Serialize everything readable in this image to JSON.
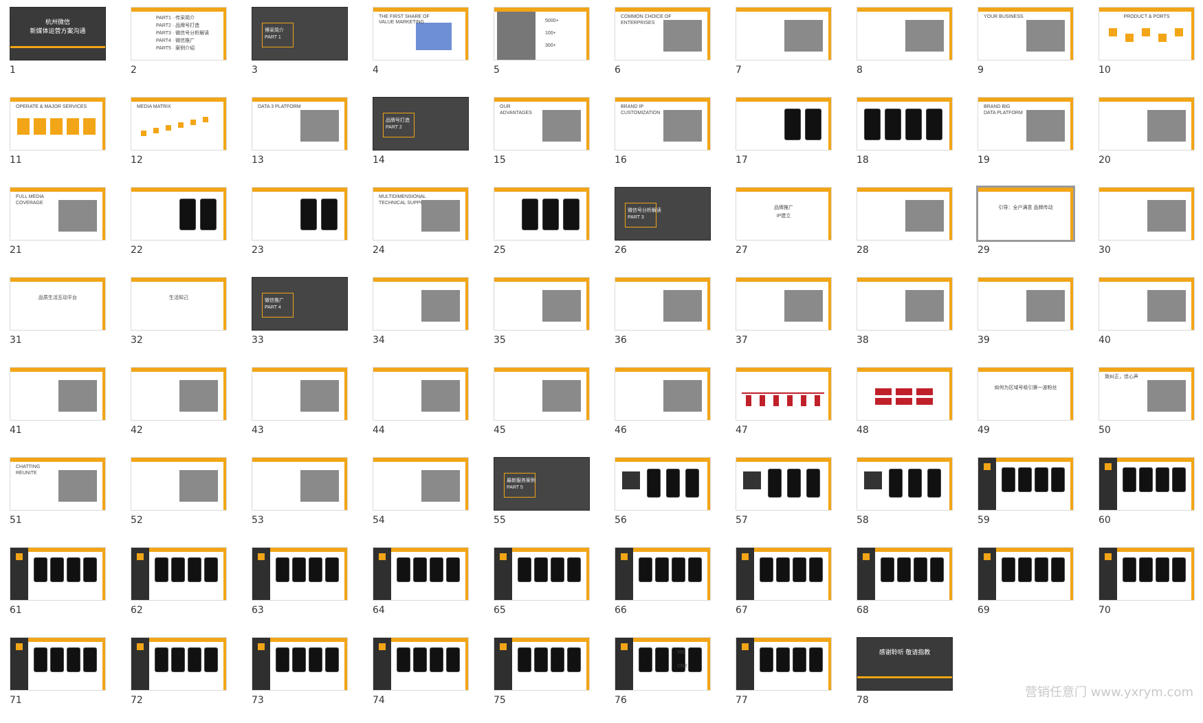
{
  "watermark": "营销任意门 www.yxrym.com",
  "colors": {
    "accent": "#f2a516",
    "dark": "#2a2a2a",
    "red": "#c0202a"
  },
  "slides": [
    {
      "n": "1",
      "theme": "dark-cover",
      "texts": [
        "杭州微信",
        "新媒体运营方案沟通"
      ]
    },
    {
      "n": "2",
      "theme": "agenda",
      "texts": [
        "PART1 · 传采简介",
        "PART2 · 品牌号打造",
        "PART3 · 微信号分析解读",
        "PART4 · 微信推广",
        "PART5 · 案例介绍"
      ]
    },
    {
      "n": "3",
      "theme": "dark-section",
      "texts": [
        "博采简介",
        "PART 1"
      ]
    },
    {
      "n": "4",
      "theme": "map",
      "texts": [
        "THE FIRST SHARE OF",
        "VALUE MARKETING"
      ]
    },
    {
      "n": "5",
      "theme": "stats",
      "texts": [
        "5000+",
        "100+",
        "300+"
      ]
    },
    {
      "n": "6",
      "theme": "bulb",
      "texts": [
        "COMMON CHOICE OF",
        "ENTERPRISES"
      ]
    },
    {
      "n": "7",
      "theme": "logos",
      "texts": []
    },
    {
      "n": "8",
      "theme": "circles",
      "texts": []
    },
    {
      "n": "9",
      "theme": "blue-split",
      "texts": [
        "YOUR BUSINESS"
      ]
    },
    {
      "n": "10",
      "theme": "wave",
      "texts": [
        "PRODUCT & PORTS"
      ]
    },
    {
      "n": "11",
      "theme": "triangles",
      "texts": [
        "OPERATE & MAJOR SERVICES"
      ]
    },
    {
      "n": "12",
      "theme": "timeline",
      "texts": [
        "MEDIA MATRIX"
      ]
    },
    {
      "n": "13",
      "theme": "boxes",
      "texts": [
        "DATA 3 PLATFORM"
      ]
    },
    {
      "n": "14",
      "theme": "dark-section",
      "texts": [
        "品牌号打造",
        "PART 2"
      ]
    },
    {
      "n": "15",
      "theme": "stairs",
      "texts": [
        "OUR",
        "ADVANTAGES"
      ]
    },
    {
      "n": "16",
      "theme": "spiral",
      "texts": [
        "BRAND IP",
        "CUSTOMIZATION"
      ]
    },
    {
      "n": "17",
      "theme": "phones2",
      "texts": []
    },
    {
      "n": "18",
      "theme": "phones4",
      "texts": []
    },
    {
      "n": "19",
      "theme": "data",
      "texts": [
        "BRAND BIG",
        "DATA PLATFORM"
      ]
    },
    {
      "n": "20",
      "theme": "monitors",
      "texts": []
    },
    {
      "n": "21",
      "theme": "cube",
      "texts": [
        "FULL MEDIA",
        "COVERAGE"
      ]
    },
    {
      "n": "22",
      "theme": "phones2",
      "texts": []
    },
    {
      "n": "23",
      "theme": "phones2",
      "texts": []
    },
    {
      "n": "24",
      "theme": "hex",
      "texts": [
        "MULTIDIMENSIONAL",
        "TECHNICAL SUPPORT"
      ]
    },
    {
      "n": "25",
      "theme": "phones3",
      "texts": []
    },
    {
      "n": "26",
      "theme": "dark-section",
      "texts": [
        "微信号分析解读",
        "PART 3"
      ]
    },
    {
      "n": "27",
      "theme": "text",
      "texts": [
        "品牌推广",
        "IP建立"
      ]
    },
    {
      "n": "28",
      "theme": "arrow",
      "texts": []
    },
    {
      "n": "29",
      "theme": "compare",
      "texts": [
        "引导：全户满意 品牌传动"
      ]
    },
    {
      "n": "30",
      "theme": "flow",
      "texts": []
    },
    {
      "n": "31",
      "theme": "text",
      "texts": [
        "品质生活互动平台"
      ]
    },
    {
      "n": "32",
      "theme": "text",
      "texts": [
        "生活知己"
      ]
    },
    {
      "n": "33",
      "theme": "dark-section",
      "texts": [
        "微信推广",
        "PART 4"
      ]
    },
    {
      "n": "34",
      "theme": "tree",
      "texts": []
    },
    {
      "n": "35",
      "theme": "gallery",
      "texts": []
    },
    {
      "n": "36",
      "theme": "gallery",
      "texts": []
    },
    {
      "n": "37",
      "theme": "gallery",
      "texts": []
    },
    {
      "n": "38",
      "theme": "gallery",
      "texts": []
    },
    {
      "n": "39",
      "theme": "gallery",
      "texts": []
    },
    {
      "n": "40",
      "theme": "gallery",
      "texts": []
    },
    {
      "n": "41",
      "theme": "gallery",
      "texts": []
    },
    {
      "n": "42",
      "theme": "gallery",
      "texts": []
    },
    {
      "n": "43",
      "theme": "gallery",
      "texts": []
    },
    {
      "n": "44",
      "theme": "night",
      "texts": []
    },
    {
      "n": "45",
      "theme": "sunset",
      "texts": []
    },
    {
      "n": "46",
      "theme": "qr",
      "texts": []
    },
    {
      "n": "47",
      "theme": "redline",
      "texts": []
    },
    {
      "n": "48",
      "theme": "redboxes",
      "texts": []
    },
    {
      "n": "49",
      "theme": "text",
      "texts": [
        "如何为区域号吸引第一波粉丝"
      ]
    },
    {
      "n": "50",
      "theme": "book",
      "texts": [
        "致纠正，佳心声"
      ]
    },
    {
      "n": "51",
      "theme": "calligraphy",
      "texts": [
        "CHATTING",
        "REUNITE"
      ]
    },
    {
      "n": "52",
      "theme": "illustration",
      "texts": []
    },
    {
      "n": "53",
      "theme": "gallery",
      "texts": []
    },
    {
      "n": "54",
      "theme": "gallery",
      "texts": []
    },
    {
      "n": "55",
      "theme": "dark-section",
      "texts": [
        "最新服务案例",
        "PART 5"
      ]
    },
    {
      "n": "56",
      "theme": "case",
      "texts": []
    },
    {
      "n": "57",
      "theme": "case",
      "texts": []
    },
    {
      "n": "58",
      "theme": "case",
      "texts": []
    },
    {
      "n": "59",
      "theme": "case-dark",
      "texts": []
    },
    {
      "n": "60",
      "theme": "case-dark",
      "texts": []
    },
    {
      "n": "61",
      "theme": "case-dark",
      "texts": []
    },
    {
      "n": "62",
      "theme": "case-dark",
      "texts": []
    },
    {
      "n": "63",
      "theme": "case-dark",
      "texts": []
    },
    {
      "n": "64",
      "theme": "case-dark",
      "texts": []
    },
    {
      "n": "65",
      "theme": "case-dark",
      "texts": []
    },
    {
      "n": "66",
      "theme": "case-dark",
      "texts": []
    },
    {
      "n": "67",
      "theme": "case-dark",
      "texts": []
    },
    {
      "n": "68",
      "theme": "case-dark",
      "texts": []
    },
    {
      "n": "69",
      "theme": "case-dark",
      "texts": []
    },
    {
      "n": "70",
      "theme": "case-dark",
      "texts": []
    },
    {
      "n": "71",
      "theme": "case-dark",
      "texts": []
    },
    {
      "n": "72",
      "theme": "case-dark",
      "texts": []
    },
    {
      "n": "73",
      "theme": "case-dark",
      "texts": []
    },
    {
      "n": "74",
      "theme": "case-dark",
      "texts": []
    },
    {
      "n": "75",
      "theme": "case-dark",
      "texts": []
    },
    {
      "n": "76",
      "theme": "case-dark",
      "texts": [
        "592",
        "ONE"
      ]
    },
    {
      "n": "77",
      "theme": "case-dark",
      "texts": []
    },
    {
      "n": "78",
      "theme": "dark-cover",
      "texts": [
        "感谢聆听 敬请指教"
      ]
    }
  ],
  "selected_slide": "29"
}
